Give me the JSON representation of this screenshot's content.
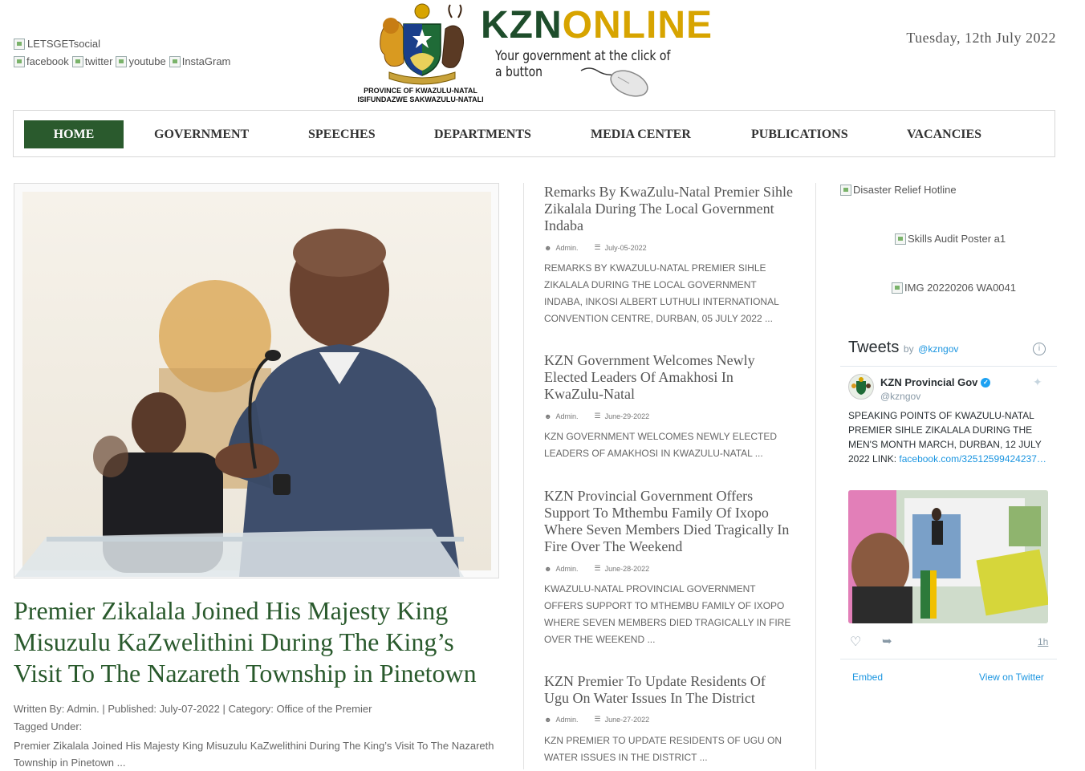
{
  "header": {
    "social_title": "LETSGETsocial",
    "social_links": [
      {
        "label": "facebook"
      },
      {
        "label": "twitter"
      },
      {
        "label": "youtube"
      },
      {
        "label": "InstaGram"
      }
    ],
    "logo": {
      "brand_left": "KZN",
      "brand_right": "ONLINE",
      "tagline": "Your government at the click of a button",
      "province_line1": "PROVINCE OF KWAZULU-NATAL",
      "province_line2": "ISIFUNDAZWE SAKWAZULU-NATALI"
    },
    "date": "Tuesday, 12th July 2022"
  },
  "nav": {
    "items": [
      {
        "label": "HOME",
        "active": true
      },
      {
        "label": "GOVERNMENT"
      },
      {
        "label": "SPEECHES"
      },
      {
        "label": "DEPARTMENTS"
      },
      {
        "label": "MEDIA CENTER"
      },
      {
        "label": "PUBLICATIONS"
      },
      {
        "label": "VACANCIES"
      }
    ]
  },
  "feature": {
    "title": "Premier Zikalala Joined His Majesty King Misuzulu KaZwelithini During The King’s Visit To The Nazareth Township in Pinetown",
    "written_by_label": "Written By:",
    "author": "Admin.",
    "published_label": "| Published:",
    "published": "July-07-2022",
    "category_label": "| Category:",
    "category": "Office of the Premier",
    "tagged_label": "Tagged Under:",
    "excerpt": "Premier Zikalala Joined His Majesty King Misuzulu KaZwelithini During The King’s Visit To The Nazareth Township in Pinetown ..."
  },
  "news": [
    {
      "title": "Remarks By KwaZulu-Natal Premier Sihle Zikalala During The Local Government Indaba",
      "author": "Admin.",
      "date": "July-05-2022",
      "excerpt": "REMARKS BY KWAZULU-NATAL PREMIER SIHLE ZIKALALA DURING THE LOCAL GOVERNMENT INDABA, INKOSI ALBERT LUTHULI INTERNATIONAL CONVENTION CENTRE, DURBAN, 05 JULY 2022 ..."
    },
    {
      "title": "KZN Government Welcomes Newly Elected Leaders Of Amakhosi In KwaZulu-Natal",
      "author": "Admin.",
      "date": "June-29-2022",
      "excerpt": "KZN GOVERNMENT WELCOMES NEWLY ELECTED LEADERS OF AMAKHOSI IN KWAZULU-NATAL ..."
    },
    {
      "title": "KZN Provincial Government Offers Support To Mthembu Family Of Ixopo Where Seven Members Died Tragically In Fire Over The Weekend",
      "author": "Admin.",
      "date": "June-28-2022",
      "excerpt": "KWAZULU-NATAL PROVINCIAL GOVERNMENT OFFERS SUPPORT TO MTHEMBU FAMILY OF IXOPO WHERE SEVEN MEMBERS DIED TRAGICALLY IN FIRE OVER THE WEEKEND ..."
    },
    {
      "title": "KZN Premier To Update Residents Of Ugu On Water Issues In The District",
      "author": "Admin.",
      "date": "June-27-2022",
      "excerpt": "KZN PREMIER TO UPDATE RESIDENTS OF UGU ON WATER ISSUES IN THE DISTRICT ..."
    }
  ],
  "sidebar": {
    "images": [
      {
        "alt": "Disaster Relief Hotline"
      },
      {
        "alt": "Skills Audit Poster a1"
      },
      {
        "alt": "IMG 20220206 WA0041"
      }
    ],
    "twitter": {
      "heading": "Tweets",
      "by": "by",
      "handle_link": "@kzngov",
      "user_name": "KZN Provincial Gov",
      "user_handle": "@kzngov",
      "tweet_text": "SPEAKING POINTS OF KWAZULU-NATAL PREMIER SIHLE ZIKALALA DURING THE MEN'S MONTH MARCH, DURBAN, 12 JULY 2022 LINK:",
      "tweet_link": "facebook.com/32512599424237…",
      "time": "1h",
      "embed": "Embed",
      "view": "View on Twitter"
    }
  },
  "colors": {
    "brand_green": "#2a5a2d",
    "brand_gold": "#d7a400",
    "twitter_blue": "#1b95e0"
  }
}
